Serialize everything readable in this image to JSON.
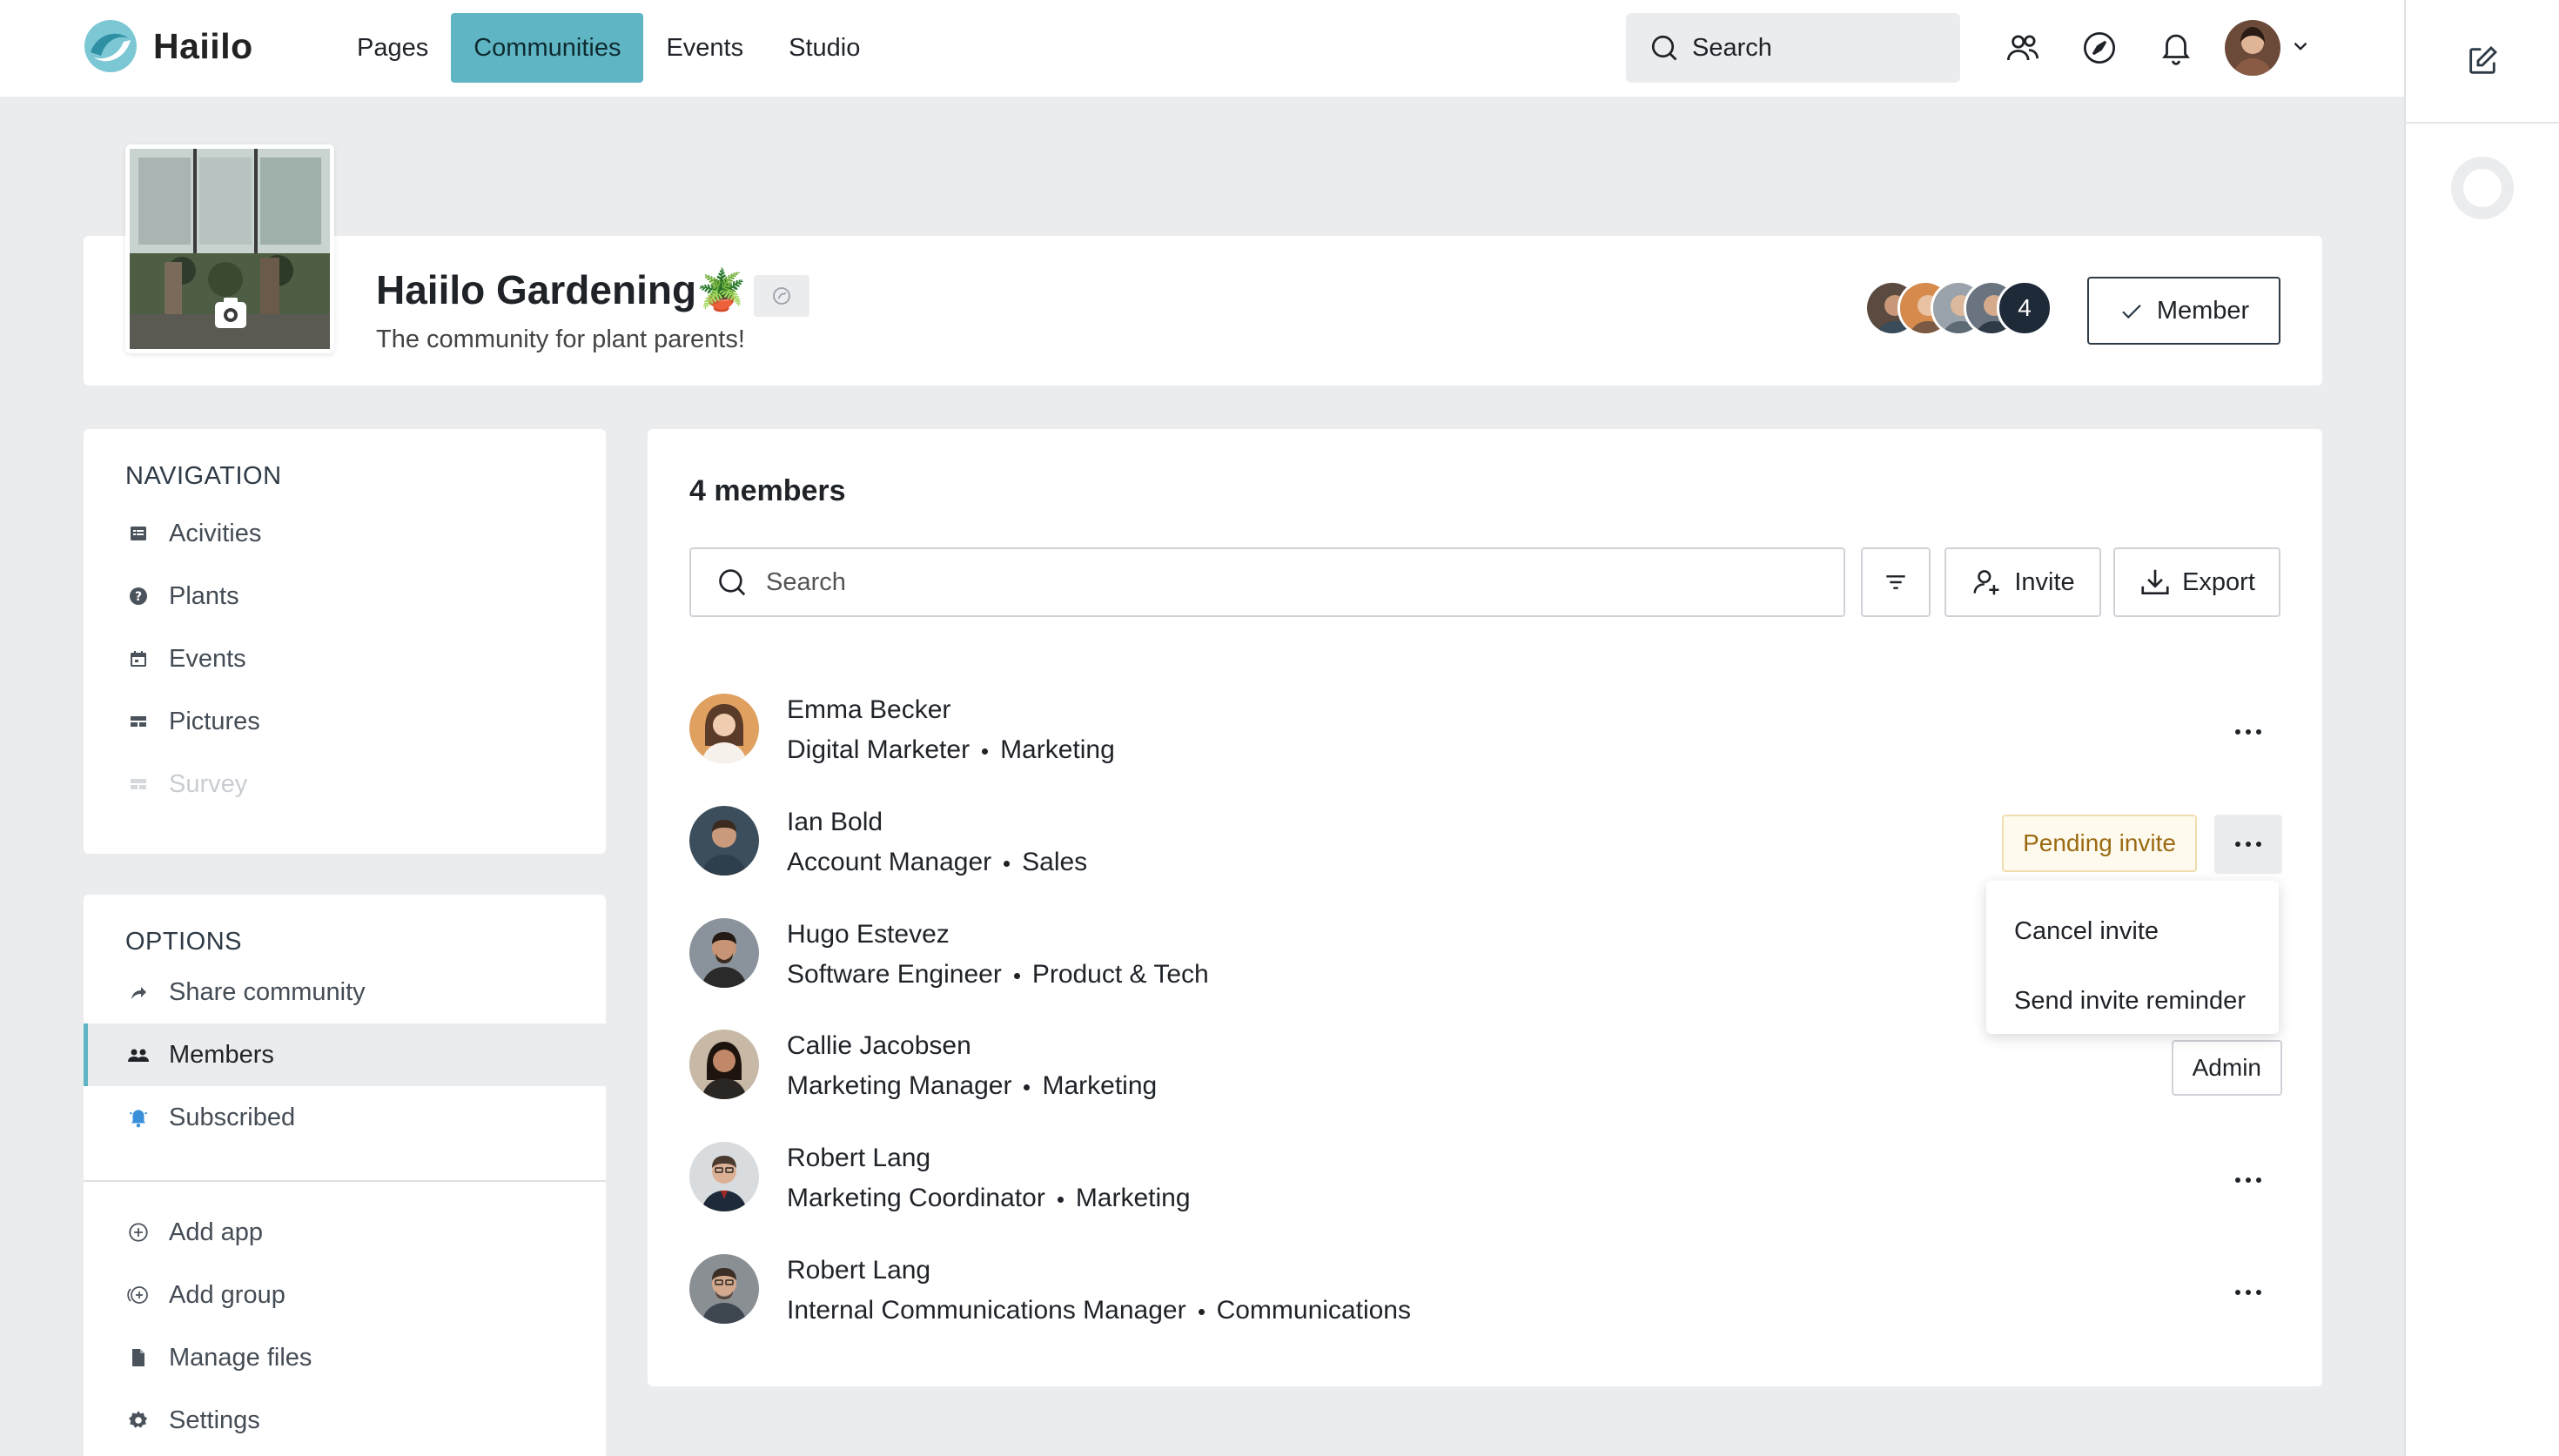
{
  "app": {
    "name": "Haiilo"
  },
  "topnav": {
    "items": [
      {
        "label": "Pages",
        "active": false
      },
      {
        "label": "Communities",
        "active": true
      },
      {
        "label": "Events",
        "active": false
      },
      {
        "label": "Studio",
        "active": false
      }
    ],
    "search_label": "Search",
    "accent_color": "#5fb5c4"
  },
  "community": {
    "title": "Haiilo Gardening🪴",
    "subtitle": "The community for plant parents!",
    "member_count_badge": "4",
    "membership_label": "Member"
  },
  "sidebar": {
    "navigation_heading": "NAVIGATION",
    "navigation": [
      {
        "label": "Acivities",
        "icon": "activities-icon",
        "disabled": false
      },
      {
        "label": "Plants",
        "icon": "help-circle-icon",
        "disabled": false
      },
      {
        "label": "Events",
        "icon": "calendar-icon",
        "disabled": false
      },
      {
        "label": "Pictures",
        "icon": "gallery-icon",
        "disabled": false
      },
      {
        "label": "Survey",
        "icon": "survey-icon",
        "disabled": true
      }
    ],
    "options_heading": "OPTIONS",
    "options": [
      {
        "label": "Share community",
        "icon": "share-icon",
        "active": false
      },
      {
        "label": "Members",
        "icon": "members-icon",
        "active": true
      },
      {
        "label": "Subscribed",
        "icon": "bell-icon",
        "active": false
      }
    ],
    "admin_options": [
      {
        "label": "Add app",
        "icon": "add-app-icon"
      },
      {
        "label": "Add group",
        "icon": "add-group-icon"
      },
      {
        "label": "Manage files",
        "icon": "file-icon"
      },
      {
        "label": "Settings",
        "icon": "gear-icon"
      }
    ]
  },
  "members": {
    "title": "4 members",
    "search_placeholder": "Search",
    "invite_label": "Invite",
    "export_label": "Export",
    "list": [
      {
        "name": "Emma Becker",
        "role": "Digital Marketer",
        "department": "Marketing",
        "badge": ""
      },
      {
        "name": "Ian Bold",
        "role": "Account Manager",
        "department": "Sales",
        "badge": "Pending invite"
      },
      {
        "name": "Hugo Estevez",
        "role": "Software Engineer",
        "department": "Product & Tech",
        "badge": ""
      },
      {
        "name": "Callie Jacobsen",
        "role": "Marketing Manager",
        "department": "Marketing",
        "badge": "Admin"
      },
      {
        "name": "Robert Lang",
        "role": "Marketing Coordinator",
        "department": "Marketing",
        "badge": ""
      },
      {
        "name": "Robert Lang",
        "role": "Internal Communications Manager",
        "department": "Communications",
        "badge": ""
      }
    ],
    "menu": {
      "cancel_label": "Cancel invite",
      "reminder_label": "Send invite reminder"
    }
  }
}
